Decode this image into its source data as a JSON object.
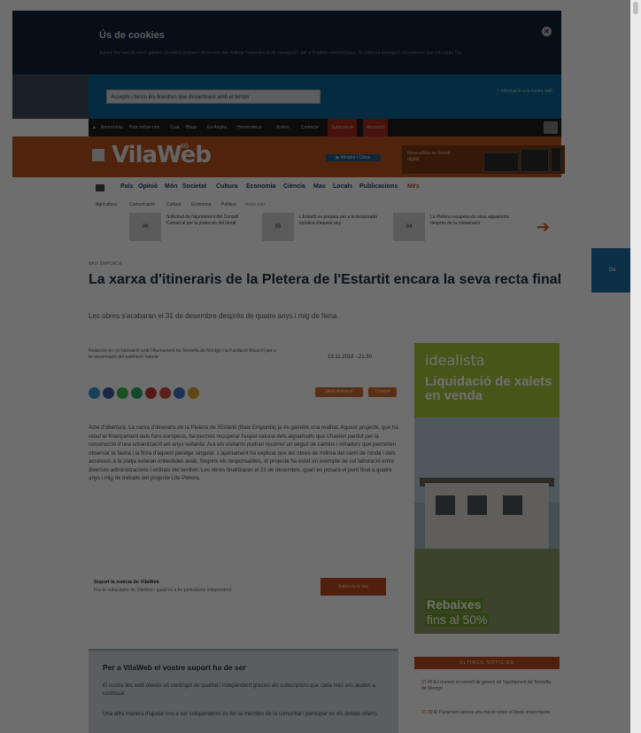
{
  "cookie": {
    "title": "Ús de cookies",
    "text": "Aquest lloc web fa servir galetes (cookies) pròpies i de tercers per millorar l'experiència de navegació i per a finalitats estadístiques. Si continua navegant, considerem que n'accepta l'ús.",
    "close_glyph": "✕"
  },
  "subbar": {
    "button": "Accepto i tanco les finestres que desactivaré amb el temps",
    "note": "+ informació a la nostra web"
  },
  "navbar": {
    "items": [
      "Anunciants",
      "Pots trobar-nos",
      "Guia",
      "Blogs",
      "En Anglès",
      "Hemeroteca",
      "Avisos",
      "Contacte"
    ],
    "red_items": [
      "Subscriu-te",
      "Anuncia't"
    ]
  },
  "header": {
    "logo": "VilaWeb",
    "logo_sup": "5G",
    "button": "▶ Mirador i Clima",
    "promo_text": "Nova edició en format digital"
  },
  "categories": [
    "País",
    "Opinió",
    "Món",
    "Societat",
    "Cultura",
    "Economia",
    "Ciència",
    "Mas",
    "Locals",
    "Publicacions"
  ],
  "categories_extra": "Més",
  "subcategories": [
    "Agricultura",
    "Comunicació",
    "Cultura",
    "Economia",
    "Política"
  ],
  "subcategories_extra": "Veure més",
  "related": [
    {
      "thumb": "06",
      "text": "Sollicitud de l'ajuntament del Consell Comarcal per la protecció del litoral"
    },
    {
      "thumb": "05",
      "text": "L'Estartit es prepara per a la temporada turística d'aquest any"
    },
    {
      "thumb": "04",
      "text": "La Pletera recupera els seus aiguamolls després de la restauració"
    }
  ],
  "article": {
    "kicker": "BAIX EMPORDÀ",
    "title": "La xarxa d'itineraris de la Pletera de l'Estartit encara la seva recta final",
    "subtitle": "Les obres s'acabaran el 31 de desembre després de quatre anys i mig de feina",
    "meta": "Redacció en col·laboració amb l'Ajuntament de Torroella de Montgrí i la Fundació Mascort per a la conservació del patrimoni natural",
    "date": "13.11.2018 - 21:30",
    "tags": [
      "Medi Ambient",
      "Turisme"
    ],
    "body": "Acte d'obertura. La xarxa d'itineraris de la Pletera de l'Estartit (Baix Empordà) ja és gairebé una realitat. Aquest projecte, que ha rebut el finançament dels fons europeus, ha permès recuperar l'espai natural dels aiguamolls que s'havien perdut per la construcció d'una urbanització als anys vuitanta. Ara els visitants podran recórrer un seguit de camins i miradors que permeten observar la fauna i la flora d'aquest paratge singular. L'ajuntament ha explicat que les obres de millora del camí de ronda i dels accessos a la platja estaran enllestides aviat. Segons els responsables, el projecte ha estat un exemple de col·laboració entre diverses administracions i entitats del territori. Les obres finalitzaran el 31 de desembre, quan es posarà el punt final a quatre anys i mig de treballs del projecte Life Pletera.",
    "support_title": "Suport la notícia de VilaWeb",
    "support_sub": "Fes-te subscriptor de VilaWeb i ajuda'ns a fer periodisme independent",
    "support_button": "Subscriu-te ara",
    "box_title": "Per a VilaWeb el vostre suport ha de ser",
    "box_text": "El nostre lloc web ofereix un contingut de qualitat i independent gràcies als subscriptors que cada mes ens ajuden a continuar.",
    "box_text2": "Una altra manera d'ajudar-nos a ser independents és fer-se membre de la comunitat i participar en els debats oberts."
  },
  "ad": {
    "brand": "idealista",
    "headline": "Liquidació de xalets en venda",
    "r1": "Rebaixes",
    "r2": "fins al 50%"
  },
  "side": {
    "heading": "ÚLTIMES NOTÍCIES",
    "items": [
      {
        "time": "21:45",
        "text": "Es reuneix el consell de govern de l'ajuntament de Torroella de Montgrí"
      },
      {
        "time": "21:30",
        "text": "El Parlament aprova una moció sobre el litoral empordanès"
      }
    ]
  },
  "float_tab": "De",
  "colors": {
    "cookie_bg": "#0f2236",
    "header": "#b5501c",
    "accent": "#b84a1c",
    "nav": "#1c1c1c",
    "title": "#1e2d3b",
    "ad": "#a6c03a"
  }
}
